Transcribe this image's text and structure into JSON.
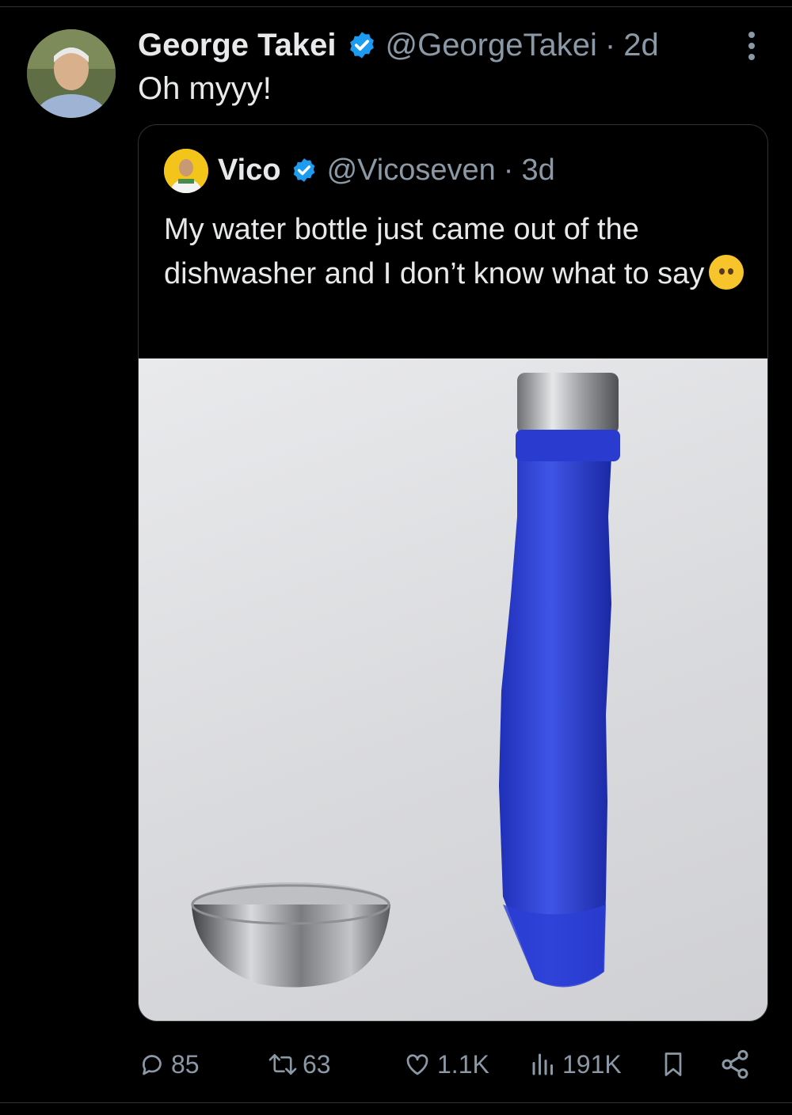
{
  "tweet": {
    "author_name": "George Takei",
    "handle": "@GeorgeTakei",
    "separator": "·",
    "time": "2d",
    "text": "Oh myyy!"
  },
  "quote": {
    "author_name": "Vico",
    "handle": "@Vicoseven",
    "separator": "·",
    "time": "3d",
    "text": "My water bottle just came out of the dishwasher and I don’t know what to say"
  },
  "actions": {
    "replies": "85",
    "retweets": "63",
    "likes": "1.1K",
    "views": "191K"
  },
  "icons": [
    "verified-badge-icon",
    "more-icon",
    "reply-icon",
    "retweet-icon",
    "like-icon",
    "views-icon",
    "bookmark-icon",
    "share-icon",
    "neutral-face-emoji"
  ],
  "colors": {
    "background": "#000000",
    "text": "#e7e9ea",
    "muted": "#8b98a5",
    "verified": "#1d9bf0",
    "border": "#2f3336"
  }
}
